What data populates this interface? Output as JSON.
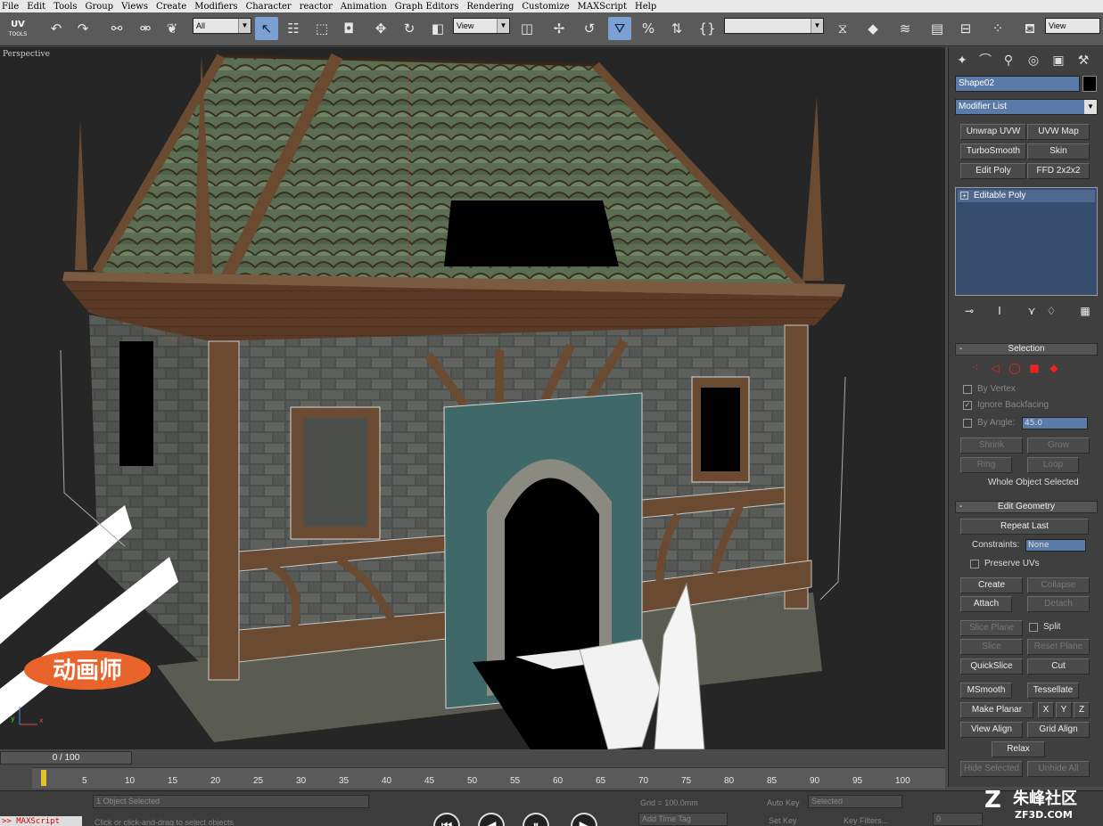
{
  "menu": [
    "File",
    "Edit",
    "Tools",
    "Group",
    "Views",
    "Create",
    "Modifiers",
    "Character",
    "reactor",
    "Animation",
    "Graph Editors",
    "Rendering",
    "Customize",
    "MAXScript",
    "Help"
  ],
  "toolbar": {
    "uv_logo": "UV",
    "uv_logo_sub": "TOOLS",
    "selection_filter": "All",
    "reference_coord": "View",
    "named_selection": "",
    "view_dropdown": "View"
  },
  "viewport": {
    "label": "Perspective"
  },
  "scene_badge": "动画师",
  "panel": {
    "object_name": "Shape02",
    "modifier_list": "Modifier List",
    "modifier_buttons": [
      "Unwrap UVW",
      "UVW Map",
      "TurboSmooth",
      "Skin",
      "Edit Poly",
      "FFD 2x2x2"
    ],
    "stack_item": "Editable Poly",
    "selection": {
      "title": "Selection",
      "by_vertex": "By Vertex",
      "ignore_backfacing": "Ignore Backfacing",
      "by_angle": "By Angle:",
      "angle_value": "45.0",
      "shrink": "Shrink",
      "grow": "Grow",
      "ring": "Ring",
      "loop": "Loop",
      "status": "Whole Object Selected"
    },
    "edit_geometry": {
      "title": "Edit Geometry",
      "repeat_last": "Repeat Last",
      "constraints_label": "Constraints:",
      "constraints_value": "None",
      "preserve_uvs": "Preserve UVs",
      "create": "Create",
      "collapse": "Collapse",
      "attach": "Attach",
      "detach": "Detach",
      "slice_plane": "Slice Plane",
      "split": "Split",
      "slice": "Slice",
      "reset_plane": "Reset Plane",
      "quickslice": "QuickSlice",
      "cut": "Cut",
      "msmooth": "MSmooth",
      "tessellate": "Tessellate",
      "make_planar": "Make Planar",
      "x": "X",
      "y": "Y",
      "z": "Z",
      "view_align": "View Align",
      "grid_align": "Grid Align",
      "relax": "Relax",
      "hide_selected": "Hide Selected",
      "unhide_all": "Unhide All"
    }
  },
  "timeline": {
    "slider": "0 / 100",
    "ticks": [
      "5",
      "10",
      "15",
      "20",
      "25",
      "30",
      "35",
      "40",
      "45",
      "50",
      "55",
      "60",
      "65",
      "70",
      "75",
      "80",
      "85",
      "90",
      "95",
      "100"
    ]
  },
  "status": {
    "selection": "1 Object Selected",
    "prompt": "Click or click-and-drag to select objects",
    "grid": "Grid = 100.0mm",
    "add_time_tag": "Add Time Tag",
    "auto_key": "Auto Key",
    "selected": "Selected",
    "set_key": "Set Key",
    "key_filters": "Key Filters...",
    "frame": "0",
    "maxscript": ">> MAXScript"
  },
  "watermark": {
    "name": "朱峰社区",
    "url": "ZF3D.COM"
  }
}
